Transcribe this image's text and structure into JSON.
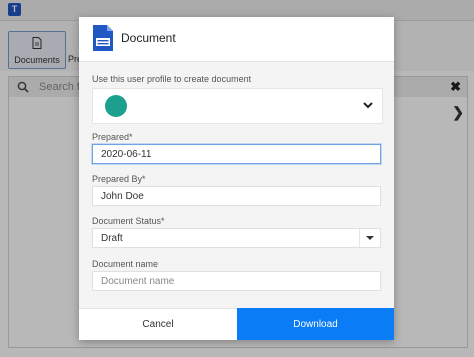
{
  "app": {
    "logo_letter": "T",
    "toolbar": {
      "documents_label": "Documents",
      "second_label": "Pre"
    },
    "search": {
      "placeholder": "Search fo",
      "clear_glyph": "✖"
    },
    "chevron_glyph": "❯"
  },
  "dialog": {
    "title": "Document",
    "profile": {
      "label": "Use this user profile to create document",
      "avatar_color": "#1aa08d"
    },
    "prepared": {
      "label": "Prepared*",
      "value": "2020-06-11"
    },
    "prepared_by": {
      "label": "Prepared By*",
      "value": "John Doe"
    },
    "status": {
      "label": "Document Status*",
      "value": "Draft"
    },
    "name": {
      "label": "Document name",
      "placeholder": "Document name"
    },
    "buttons": {
      "cancel": "Cancel",
      "download": "Download"
    }
  },
  "colors": {
    "accent": "#0a7cf5",
    "doc_icon": "#1f57c3"
  }
}
